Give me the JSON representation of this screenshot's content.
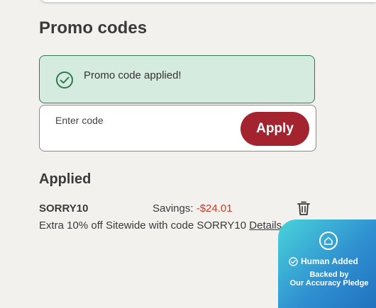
{
  "promo": {
    "heading": "Promo codes",
    "success_message": "Promo code applied!",
    "input_placeholder": "Enter code",
    "input_value": "",
    "apply_label": "Apply"
  },
  "applied": {
    "heading": "Applied",
    "code": "SORRY10",
    "savings_label": "Savings:",
    "savings_amount": "-$24.01",
    "description": "Extra 10% off Sitewide with code SORRY10",
    "details_label": "Details"
  },
  "badge": {
    "title": "Human Added",
    "subtitle_line1": "Backed by",
    "subtitle_line2": "Our Accuracy Pledge"
  },
  "icons": {
    "success": "check-circle-icon",
    "remove": "trash-icon",
    "badge_logo": "home-icon",
    "badge_check": "check-circle-icon"
  },
  "colors": {
    "background": "#f3f1ee",
    "success_bg": "#d6ebdf",
    "success_border": "#2d7a4b",
    "apply_button": "#a3232e",
    "savings_red": "#c93a2a",
    "badge_gradient_start": "#49d3da",
    "badge_gradient_end": "#1f6fbd"
  }
}
